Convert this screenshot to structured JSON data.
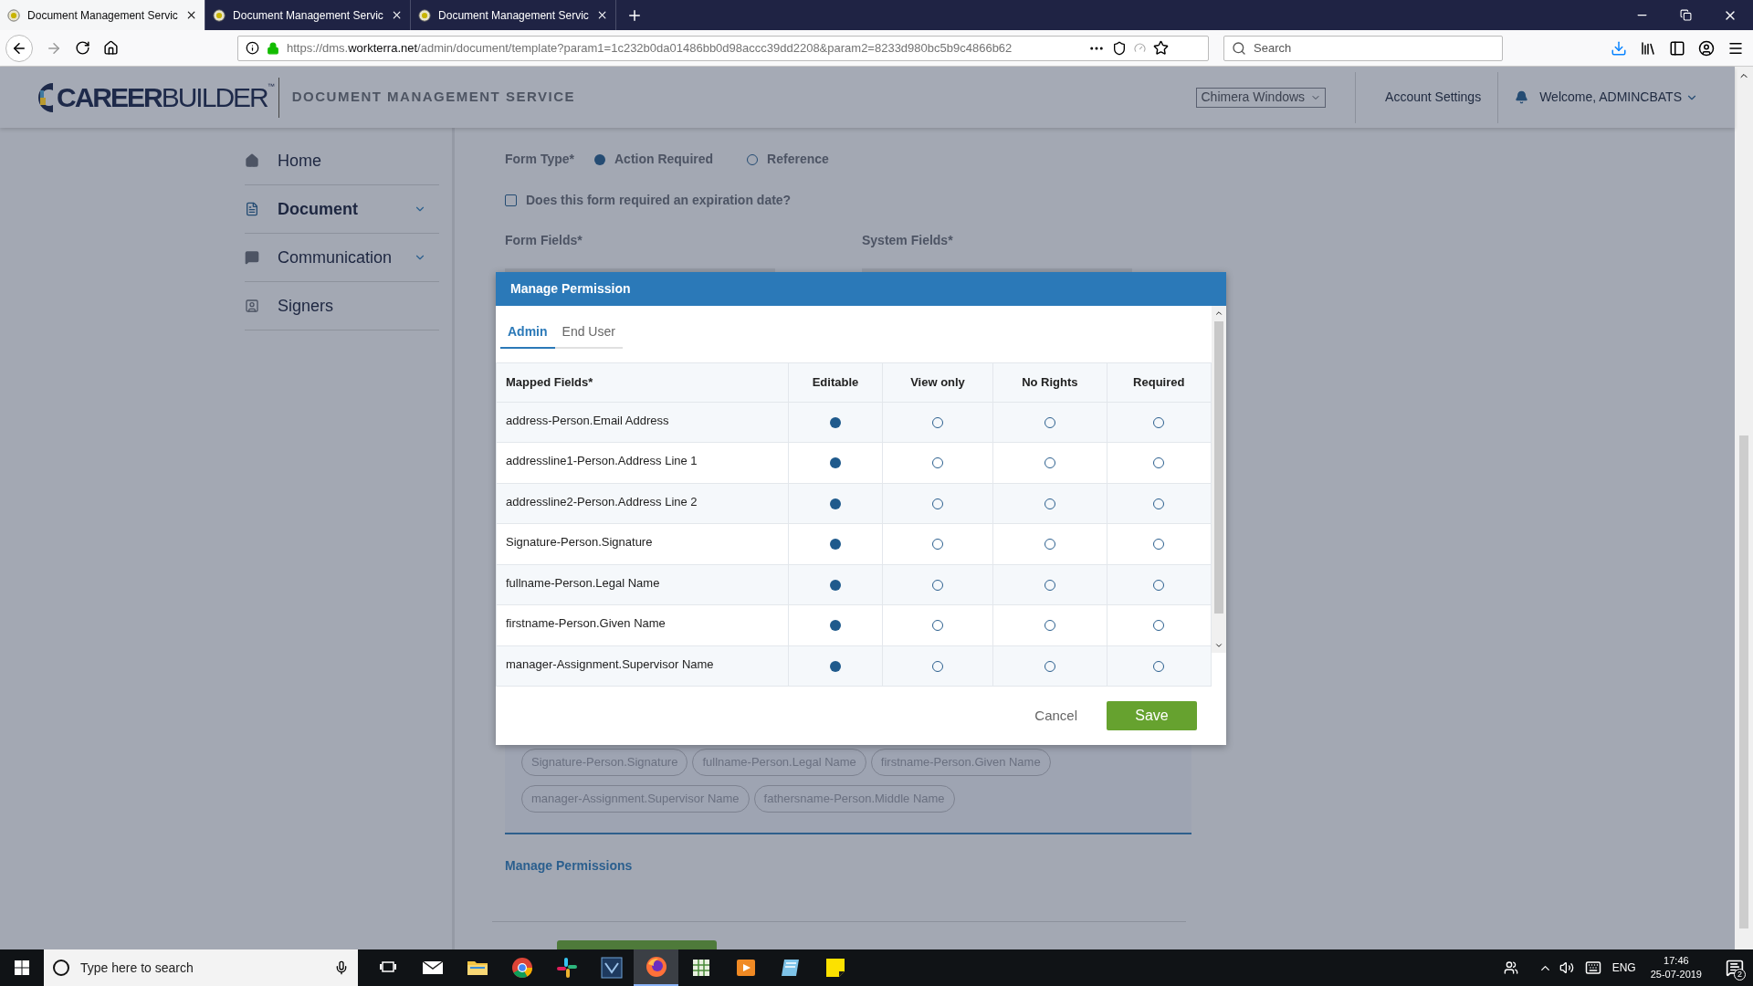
{
  "browser": {
    "tabs": [
      {
        "title": "Document Management Servic",
        "selected": true
      },
      {
        "title": "Document Management Servic",
        "selected": false
      },
      {
        "title": "Document Management Servic",
        "selected": false
      }
    ],
    "url_scheme": "https://dms.",
    "url_domain": "workterra.net",
    "url_path": "/admin/document/template?param1=1c232b0da01486bb0d98accc39dd2208&param2=8233d980bc5b9c4866b62",
    "search": {
      "placeholder": "Search"
    }
  },
  "header": {
    "logo_bold": "CAREER",
    "logo_light": "BUILDER",
    "logo_mark": "™",
    "service_title": "DOCUMENT MANAGEMENT SERVICE",
    "company_select": "Chimera Windows",
    "account_settings": "Account Settings",
    "welcome": "Welcome, ADMINCBATS"
  },
  "sidebar": {
    "items": [
      {
        "label": "Home",
        "kind": "home",
        "selected": false,
        "has_menu": false
      },
      {
        "label": "Document",
        "kind": "document",
        "selected": true,
        "has_menu": true
      },
      {
        "label": "Communication",
        "kind": "chat",
        "selected": false,
        "has_menu": true
      },
      {
        "label": "Signers",
        "kind": "signers",
        "selected": false,
        "has_menu": false
      }
    ]
  },
  "form": {
    "form_type_label": "Form Type*",
    "form_types": [
      {
        "label": "Action Required",
        "selected": true
      },
      {
        "label": "Reference",
        "selected": false
      }
    ],
    "expiration": {
      "label": "Does this form required an expiration date?",
      "checked": false
    },
    "form_fields_label": "Form Fields*",
    "system_fields_label": "System Fields*",
    "chips": [
      "Signature-Person.Signature",
      "fullname-Person.Legal Name",
      "firstname-Person.Given Name",
      "manager-Assignment.Supervisor Name",
      "fathersname-Person.Middle Name"
    ],
    "manage_permissions_link": "Manage Permissions"
  },
  "modal": {
    "title": "Manage Permission",
    "tabs": [
      {
        "label": "Admin",
        "selected": true
      },
      {
        "label": "End User",
        "selected": false
      }
    ],
    "columns": [
      "Mapped Fields*",
      "Editable",
      "View only",
      "No Rights",
      "Required"
    ],
    "rows": [
      {
        "field": "address-Person.Email Address",
        "options": [
          {
            "selected": true
          },
          {
            "selected": false
          },
          {
            "selected": false
          },
          {
            "selected": false
          }
        ]
      },
      {
        "field": "addressline1-Person.Address Line 1",
        "options": [
          {
            "selected": true
          },
          {
            "selected": false
          },
          {
            "selected": false
          },
          {
            "selected": false
          }
        ]
      },
      {
        "field": "addressline2-Person.Address Line 2",
        "options": [
          {
            "selected": true
          },
          {
            "selected": false
          },
          {
            "selected": false
          },
          {
            "selected": false
          }
        ]
      },
      {
        "field": "Signature-Person.Signature",
        "options": [
          {
            "selected": true
          },
          {
            "selected": false
          },
          {
            "selected": false
          },
          {
            "selected": false
          }
        ]
      },
      {
        "field": "fullname-Person.Legal Name",
        "options": [
          {
            "selected": true
          },
          {
            "selected": false
          },
          {
            "selected": false
          },
          {
            "selected": false
          }
        ]
      },
      {
        "field": "firstname-Person.Given Name",
        "options": [
          {
            "selected": true
          },
          {
            "selected": false
          },
          {
            "selected": false
          },
          {
            "selected": false
          }
        ]
      },
      {
        "field": "manager-Assignment.Supervisor Name",
        "options": [
          {
            "selected": true
          },
          {
            "selected": false
          },
          {
            "selected": false
          },
          {
            "selected": false
          }
        ]
      }
    ],
    "cancel": "Cancel",
    "save": "Save"
  },
  "taskbar": {
    "search_placeholder": "Type here to search",
    "apps": [
      {
        "kind": "taskview",
        "selected": false
      },
      {
        "kind": "mail",
        "selected": false
      },
      {
        "kind": "folder",
        "selected": false
      },
      {
        "kind": "chrome",
        "selected": false
      },
      {
        "kind": "slack",
        "selected": false
      },
      {
        "kind": "vs",
        "selected": false
      },
      {
        "kind": "firefox",
        "selected": true
      },
      {
        "kind": "sheet",
        "selected": false
      },
      {
        "kind": "media",
        "selected": false
      },
      {
        "kind": "notebook",
        "selected": false
      },
      {
        "kind": "notes",
        "selected": false
      }
    ],
    "language": "ENG",
    "time": "17:46",
    "date": "25-07-2019",
    "notifications": "2"
  }
}
